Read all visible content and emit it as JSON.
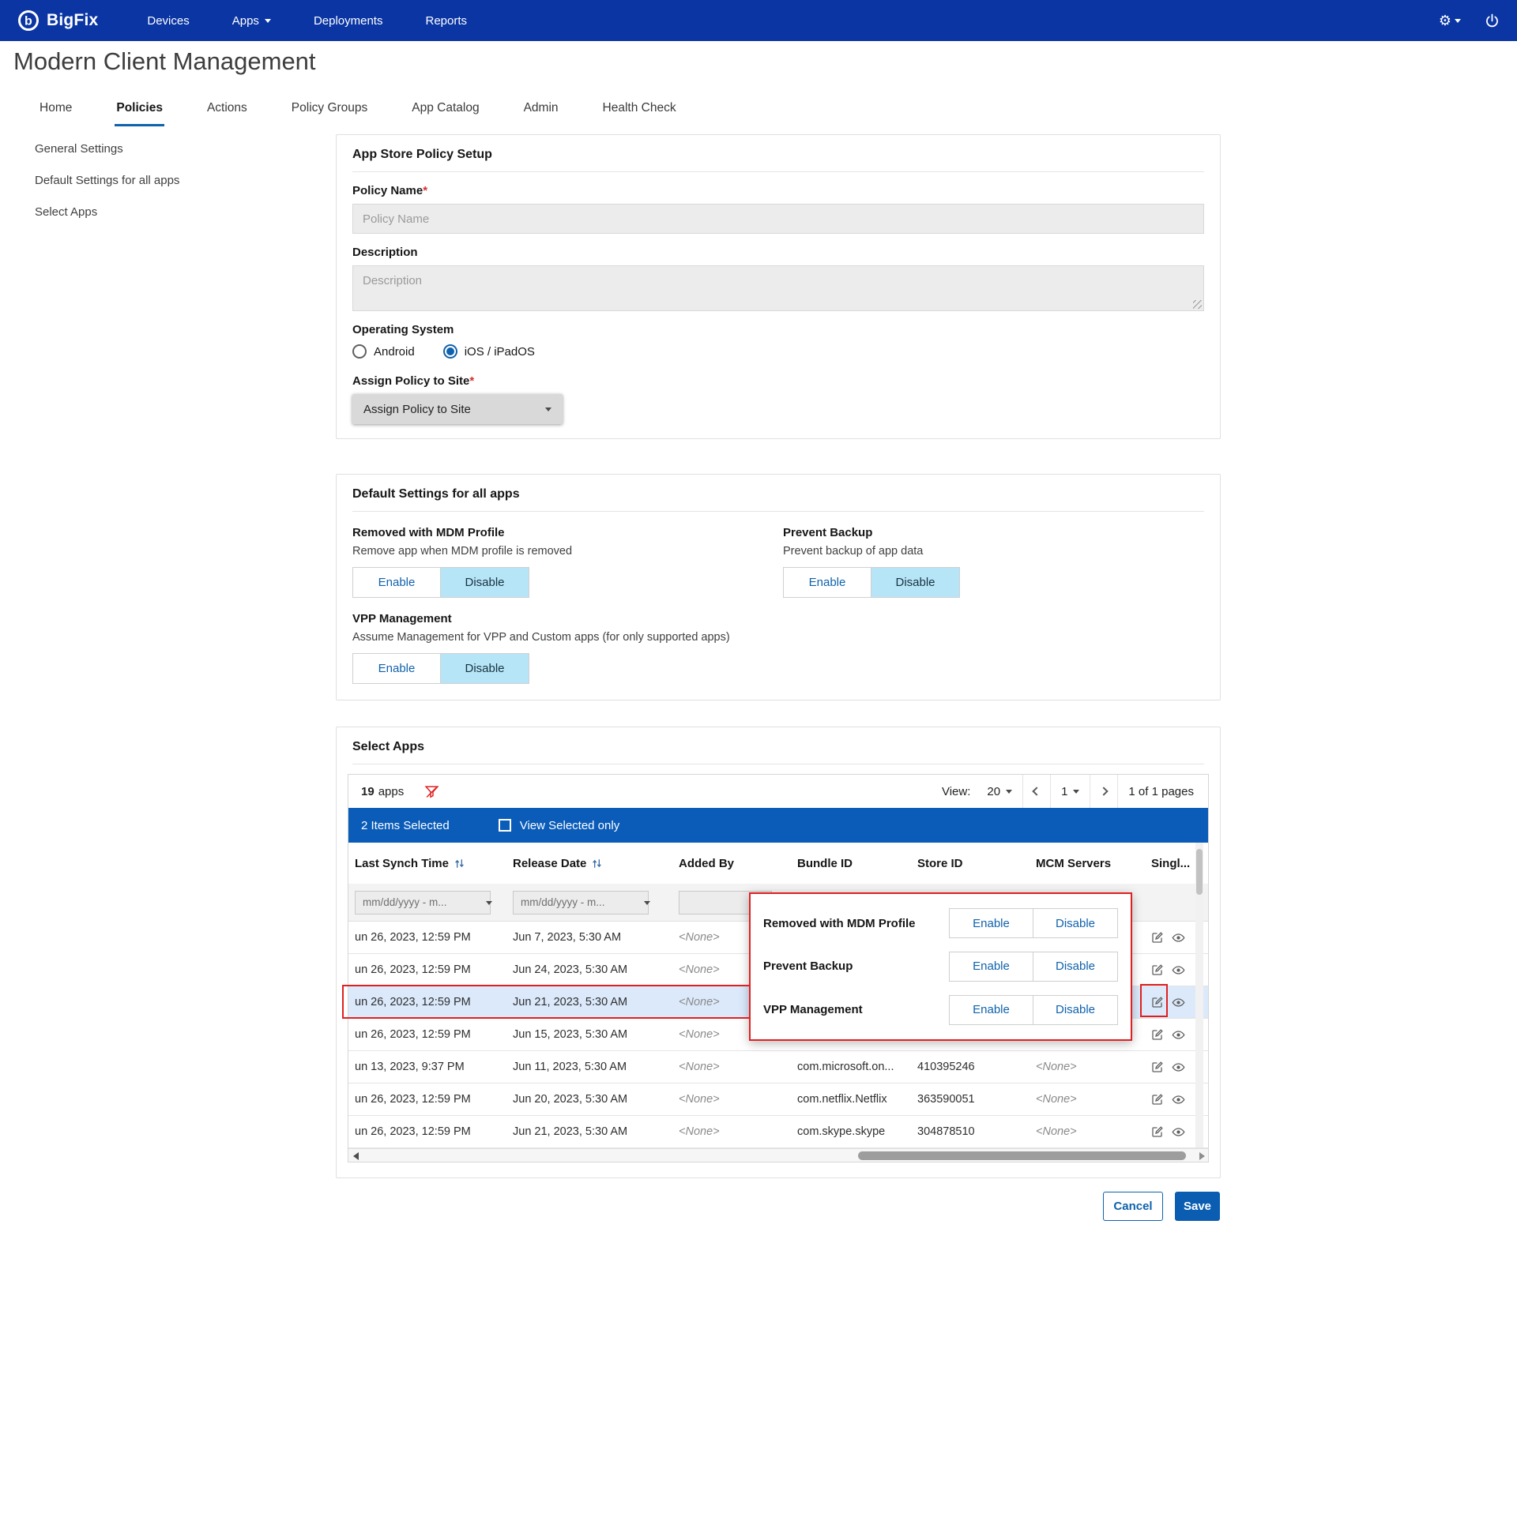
{
  "colors": {
    "navbar_bg": "#0a35a3",
    "accent_blue": "#0f62ac",
    "selection_bar_bg": "#0a5cb8",
    "toggle_disable_active_bg": "#b7e5f8",
    "highlight_red": "#e02020",
    "save_button_bg": "#0a5db0"
  },
  "navbar": {
    "brand": "BigFix",
    "items": [
      {
        "label": "Devices"
      },
      {
        "label": "Apps"
      },
      {
        "label": "Deployments"
      },
      {
        "label": "Reports"
      }
    ]
  },
  "page": {
    "title": "Modern Client Management"
  },
  "tabs": [
    {
      "label": "Home",
      "active": false
    },
    {
      "label": "Policies",
      "active": true
    },
    {
      "label": "Actions",
      "active": false
    },
    {
      "label": "Policy Groups",
      "active": false
    },
    {
      "label": "App Catalog",
      "active": false
    },
    {
      "label": "Admin",
      "active": false
    },
    {
      "label": "Health Check",
      "active": false
    }
  ],
  "sidebar": {
    "items": [
      {
        "label": "General Settings"
      },
      {
        "label": "Default Settings for all apps"
      },
      {
        "label": "Select Apps"
      }
    ]
  },
  "policy_setup": {
    "title": "App Store Policy Setup",
    "required_marker": "*",
    "policy_name_label": "Policy Name",
    "policy_name_placeholder": "Policy Name",
    "policy_name_value": "",
    "description_label": "Description",
    "description_placeholder": "Description",
    "description_value": "",
    "os_label": "Operating System",
    "os_options": [
      {
        "label": "Android",
        "selected": false
      },
      {
        "label": "iOS / iPadOS",
        "selected": true
      }
    ],
    "assign_site_label": "Assign Policy to Site",
    "assign_site_value": "Assign Policy to Site"
  },
  "default_settings": {
    "title": "Default Settings for all apps",
    "enable_label": "Enable",
    "disable_label": "Disable",
    "settings": [
      {
        "name": "Removed with MDM Profile",
        "description": "Remove app when MDM profile is removed",
        "value": "Disable"
      },
      {
        "name": "Prevent Backup",
        "description": "Prevent backup of app data",
        "value": "Disable"
      },
      {
        "name": "VPP Management",
        "description": "Assume Management for VPP and Custom apps (for only supported apps)",
        "value": "Disable"
      }
    ]
  },
  "select_apps": {
    "title": "Select Apps",
    "toolbar": {
      "count": "19",
      "count_label": "apps",
      "view_label": "View:",
      "page_size": "20",
      "current_page": "1",
      "pages_label": "1 of 1 pages"
    },
    "selection_bar": {
      "selected_text": "2 Items Selected",
      "view_selected_label": "View Selected only"
    },
    "columns": [
      "Last Synch Time",
      "Release Date",
      "Added By",
      "Bundle ID",
      "Store ID",
      "MCM Servers",
      "Singl..."
    ],
    "date_filter_placeholder": "mm/dd/yyyy - m...",
    "rows": [
      {
        "last_synch": "un 26, 2023, 12:59 PM",
        "release_date": "Jun 7, 2023, 5:30 AM",
        "added_by": "<None>",
        "bundle_id": "",
        "store_id": "",
        "mcm_servers": "",
        "selected": false
      },
      {
        "last_synch": "un 26, 2023, 12:59 PM",
        "release_date": "Jun 24, 2023, 5:30 AM",
        "added_by": "<None>",
        "bundle_id": "",
        "store_id": "",
        "mcm_servers": "",
        "selected": false
      },
      {
        "last_synch": "un 26, 2023, 12:59 PM",
        "release_date": "Jun 21, 2023, 5:30 AM",
        "added_by": "<None>",
        "bundle_id": "",
        "store_id": "",
        "mcm_servers": "",
        "selected": true
      },
      {
        "last_synch": "un 26, 2023, 12:59 PM",
        "release_date": "Jun 15, 2023, 5:30 AM",
        "added_by": "<None>",
        "bundle_id": "",
        "store_id": "",
        "mcm_servers": "",
        "selected": false
      },
      {
        "last_synch": "un 13, 2023, 9:37 PM",
        "release_date": "Jun 11, 2023, 5:30 AM",
        "added_by": "<None>",
        "bundle_id": "com.microsoft.on...",
        "store_id": "410395246",
        "mcm_servers": "<None>",
        "selected": false
      },
      {
        "last_synch": "un 26, 2023, 12:59 PM",
        "release_date": "Jun 20, 2023, 5:30 AM",
        "added_by": "<None>",
        "bundle_id": "com.netflix.Netflix",
        "store_id": "363590051",
        "mcm_servers": "<None>",
        "selected": false
      },
      {
        "last_synch": "un 26, 2023, 12:59 PM",
        "release_date": "Jun 21, 2023, 5:30 AM",
        "added_by": "<None>",
        "bundle_id": "com.skype.skype",
        "store_id": "304878510",
        "mcm_servers": "<None>",
        "selected": false
      }
    ]
  },
  "popup": {
    "enable_label": "Enable",
    "disable_label": "Disable",
    "settings": [
      {
        "name": "Removed with MDM Profile"
      },
      {
        "name": "Prevent Backup"
      },
      {
        "name": "VPP Management"
      }
    ]
  },
  "footer": {
    "cancel_label": "Cancel",
    "save_label": "Save"
  }
}
